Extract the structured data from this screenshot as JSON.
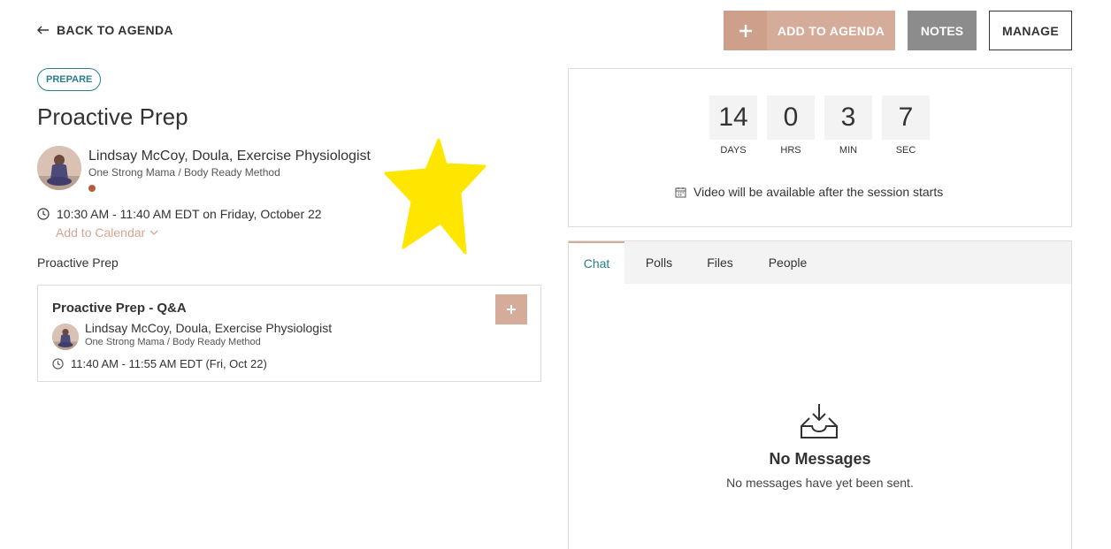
{
  "nav": {
    "back_label": "BACK TO AGENDA"
  },
  "actions": {
    "add_to_agenda": "ADD TO AGENDA",
    "notes": "NOTES",
    "manage": "MANAGE"
  },
  "session": {
    "badge": "PREPARE",
    "title": "Proactive Prep",
    "speaker": {
      "name": "Lindsay McCoy, Doula, Exercise Physiologist",
      "org": "One Strong Mama / Body Ready Method"
    },
    "time": "10:30 AM - 11:40 AM EDT on Friday, October 22",
    "add_to_calendar": "Add to Calendar",
    "description": "Proactive Prep"
  },
  "sub_session": {
    "title": "Proactive Prep - Q&A",
    "speaker_name": "Lindsay McCoy, Doula, Exercise Physiologist",
    "speaker_org": "One Strong Mama / Body Ready Method",
    "time": "11:40 AM - 11:55 AM EDT (Fri, Oct 22)"
  },
  "countdown": {
    "days": "14",
    "days_label": "DAYS",
    "hrs": "0",
    "hrs_label": "HRS",
    "min": "3",
    "min_label": "MIN",
    "sec": "7",
    "sec_label": "SEC",
    "note": "Video will be available after the session starts"
  },
  "tabs": [
    "Chat",
    "Polls",
    "Files",
    "People"
  ],
  "chat": {
    "empty_title": "No Messages",
    "empty_subtitle": "No messages have yet been sent."
  },
  "colors": {
    "accent": "#d5ab99",
    "teal": "#2a7f8a",
    "star": "#ffe600"
  }
}
